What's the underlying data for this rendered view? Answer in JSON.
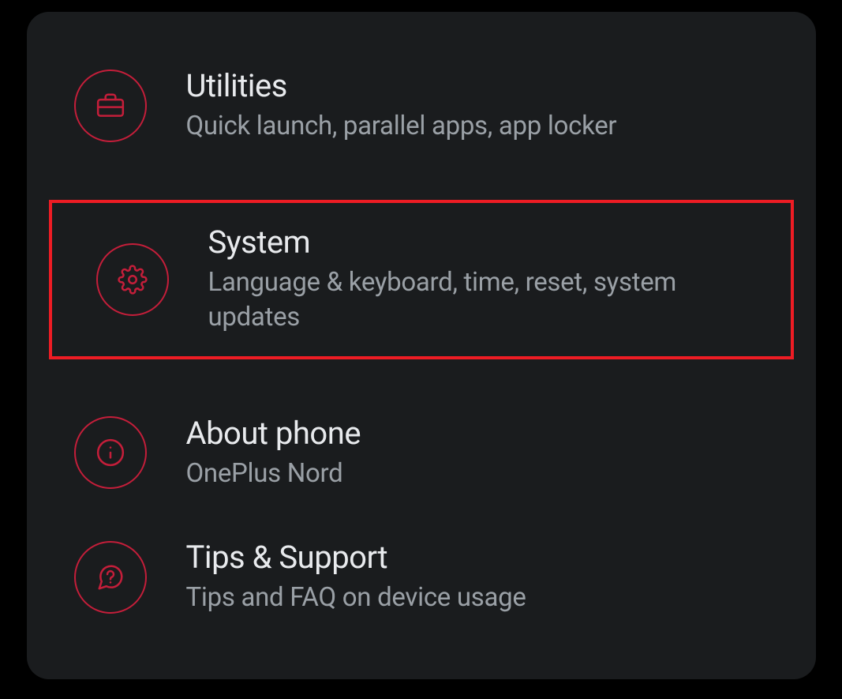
{
  "settings": {
    "utilities": {
      "title": "Utilities",
      "subtitle": "Quick launch, parallel apps, app locker",
      "icon": "briefcase-icon",
      "highlighted": false
    },
    "system": {
      "title": "System",
      "subtitle": "Language & keyboard, time, reset, system updates",
      "icon": "gear-icon",
      "highlighted": true
    },
    "about": {
      "title": "About phone",
      "subtitle": "OnePlus Nord",
      "icon": "info-icon",
      "highlighted": false
    },
    "tips": {
      "title": "Tips & Support",
      "subtitle": "Tips and FAQ on device usage",
      "icon": "help-icon",
      "highlighted": false
    }
  },
  "colors": {
    "accent": "#c41e3a",
    "highlight": "#ed1c24",
    "background": "#1a1c1e",
    "titleText": "#e8eaed",
    "subtitleText": "#9aa0a6"
  }
}
